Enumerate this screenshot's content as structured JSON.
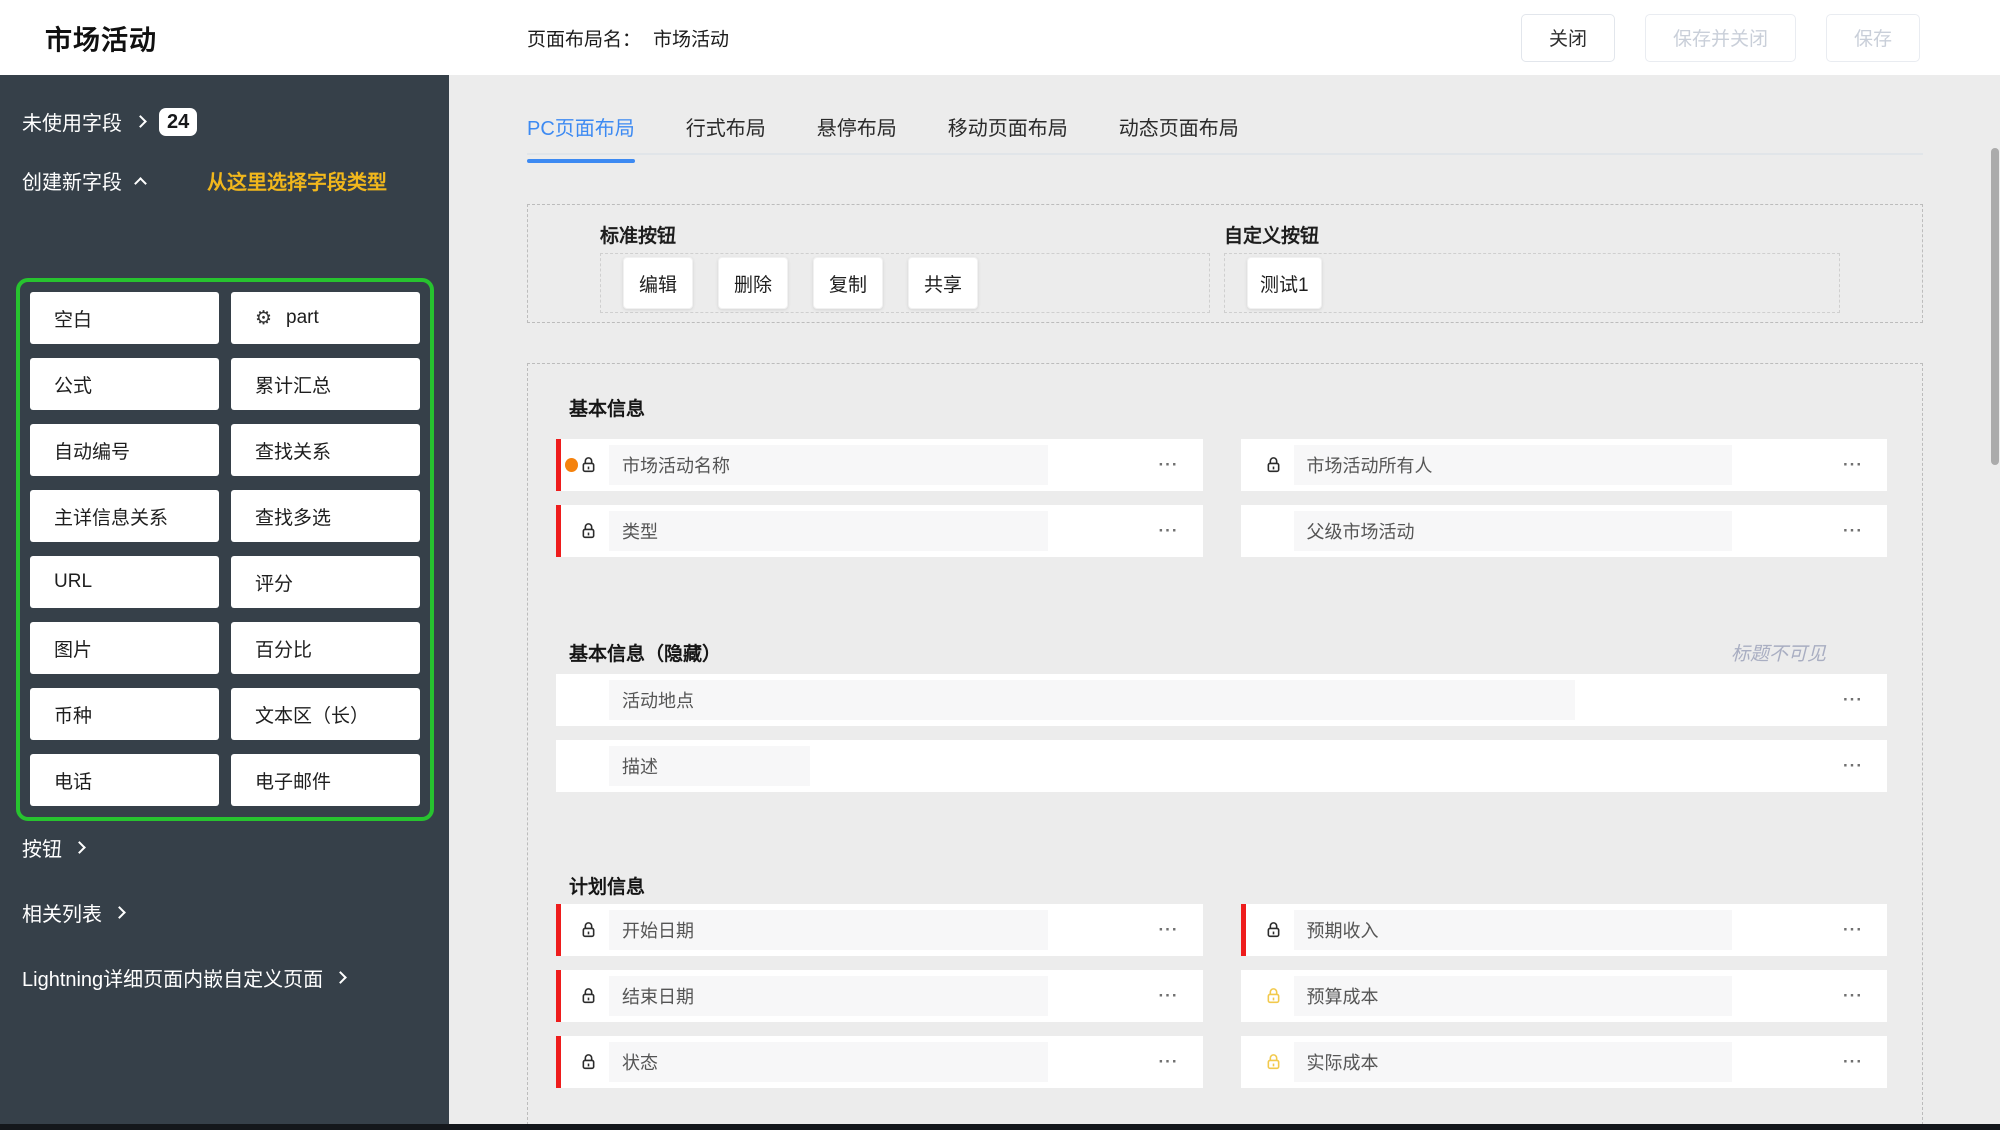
{
  "header": {
    "app_title": "市场活动",
    "layout_name_label": "页面布局名：",
    "layout_name_value": "市场活动",
    "close_label": "关闭",
    "save_close_label": "保存并关闭",
    "save_label": "保存"
  },
  "sidebar": {
    "unused_fields_label": "未使用字段",
    "unused_fields_count": "24",
    "create_field_label": "创建新字段",
    "hint": "从这里选择字段类型",
    "field_types": [
      {
        "label": "空白"
      },
      {
        "label": "part",
        "icon": "gear-icon"
      },
      {
        "label": "公式"
      },
      {
        "label": "累计汇总"
      },
      {
        "label": "自动编号"
      },
      {
        "label": "查找关系"
      },
      {
        "label": "主详信息关系"
      },
      {
        "label": "查找多选"
      },
      {
        "label": "URL"
      },
      {
        "label": "评分"
      },
      {
        "label": "图片"
      },
      {
        "label": "百分比"
      },
      {
        "label": "币种"
      },
      {
        "label": "文本区（长）"
      },
      {
        "label": "电话"
      },
      {
        "label": "电子邮件"
      }
    ],
    "links": [
      "按钮",
      "相关列表",
      "Lightning详细页面内嵌自定义页面"
    ]
  },
  "tabs": [
    "PC页面布局",
    "行式布局",
    "悬停布局",
    "移动页面布局",
    "动态页面布局"
  ],
  "active_tab": "PC页面布局",
  "buttons_panel": {
    "standard_label": "标准按钮",
    "standard_buttons": [
      "编辑",
      "删除",
      "复制",
      "共享"
    ],
    "custom_label": "自定义按钮",
    "custom_buttons": [
      "测试1"
    ]
  },
  "sections": [
    {
      "title": "基本信息",
      "layout": "two-col",
      "fields": [
        {
          "label": "市场活动名称",
          "required": true,
          "lock": "dark",
          "dot": true
        },
        {
          "label": "市场活动所有人",
          "lock": "dark"
        },
        {
          "label": "类型",
          "required": true,
          "lock": "dark"
        },
        {
          "label": "父级市场活动"
        }
      ]
    },
    {
      "title": "基本信息（隐藏）",
      "note": "标题不可见",
      "layout": "full",
      "fields": [
        {
          "label": "活动地点",
          "box": "long"
        },
        {
          "label": "描述",
          "box": "short"
        }
      ]
    },
    {
      "title": "计划信息",
      "layout": "two-col",
      "fields": [
        {
          "label": "开始日期",
          "required": true,
          "lock": "dark"
        },
        {
          "label": "预期收入",
          "required": true,
          "lock": "dark"
        },
        {
          "label": "结束日期",
          "required": true,
          "lock": "dark"
        },
        {
          "label": "预算成本",
          "lock": "yellow"
        },
        {
          "label": "状态",
          "required": true,
          "lock": "dark"
        },
        {
          "label": "实际成本",
          "lock": "yellow"
        }
      ]
    }
  ],
  "icons": {
    "gear": "⚙",
    "more": "···",
    "lock": "padlock"
  },
  "colors": {
    "accent_blue": "#3d8af2",
    "sidebar_bg": "#364049",
    "highlight_green": "#27c32f",
    "hint_yellow": "#f1b71c",
    "required_red": "#ee1c1c",
    "dot_orange": "#f5820d",
    "lock_yellow": "#f2c94c"
  }
}
